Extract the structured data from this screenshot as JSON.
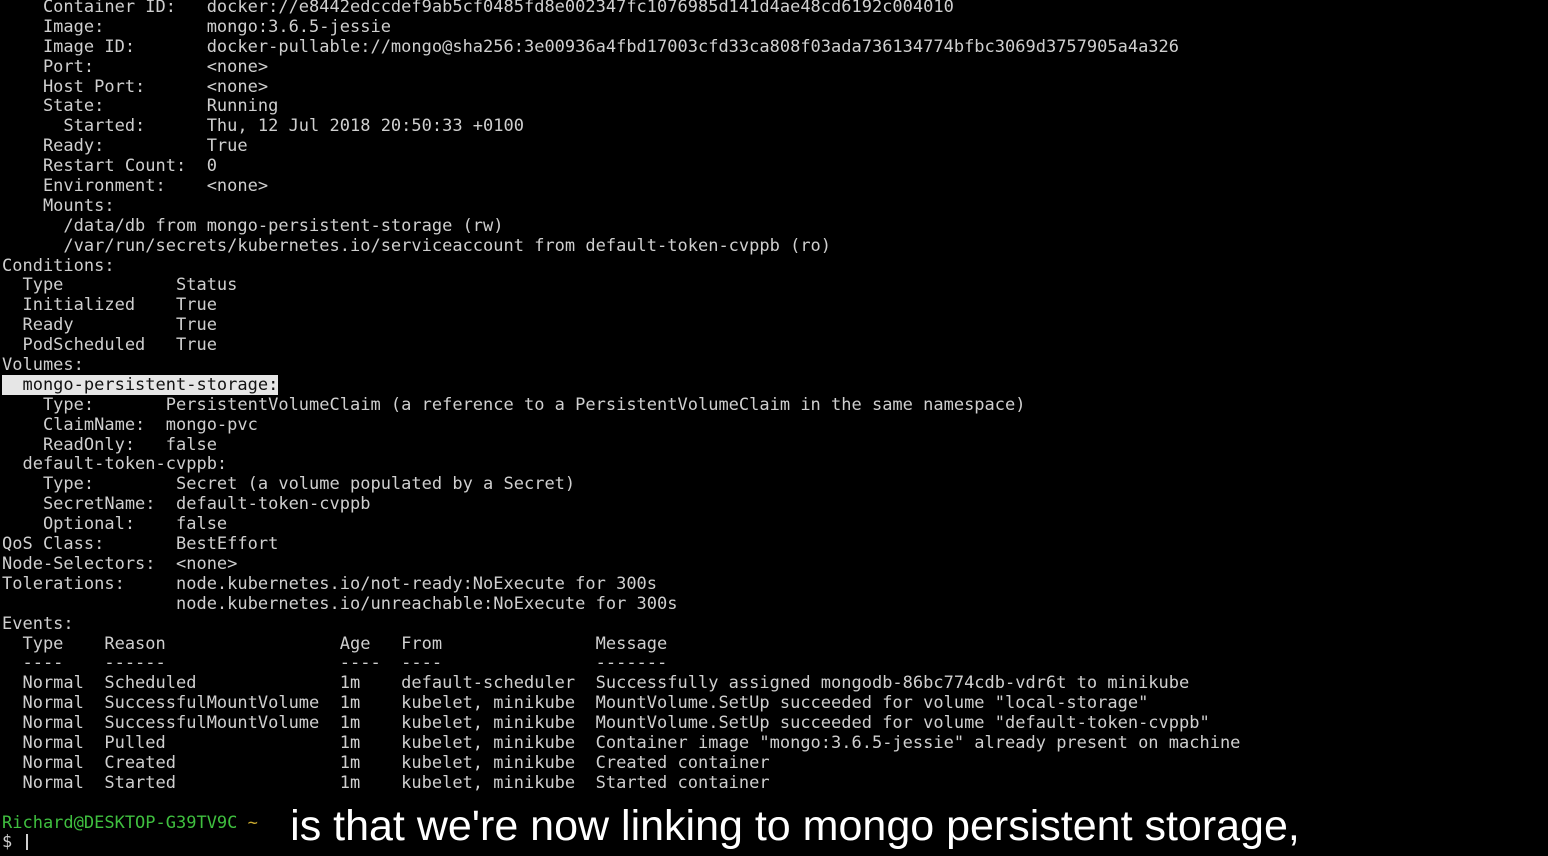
{
  "terminal": {
    "lines": [
      "    Container ID:   docker://e8442edccdef9ab5cf0485fd8e002347fc1076985d141d4ae48cd6192c004010",
      "    Image:          mongo:3.6.5-jessie",
      "    Image ID:       docker-pullable://mongo@sha256:3e00936a4fbd17003cfd33ca808f03ada736134774bfbc3069d3757905a4a326",
      "    Port:           <none>",
      "    Host Port:      <none>",
      "    State:          Running",
      "      Started:      Thu, 12 Jul 2018 20:50:33 +0100",
      "    Ready:          True",
      "    Restart Count:  0",
      "    Environment:    <none>",
      "    Mounts:",
      "      /data/db from mongo-persistent-storage (rw)",
      "      /var/run/secrets/kubernetes.io/serviceaccount from default-token-cvppb (ro)",
      "Conditions:",
      "  Type           Status",
      "  Initialized    True",
      "  Ready          True",
      "  PodScheduled   True",
      "Volumes:",
      "",
      "    Type:       PersistentVolumeClaim (a reference to a PersistentVolumeClaim in the same namespace)",
      "    ClaimName:  mongo-pvc",
      "    ReadOnly:   false",
      "  default-token-cvppb:",
      "    Type:        Secret (a volume populated by a Secret)",
      "    SecretName:  default-token-cvppb",
      "    Optional:    false",
      "QoS Class:       BestEffort",
      "Node-Selectors:  <none>",
      "Tolerations:     node.kubernetes.io/not-ready:NoExecute for 300s",
      "                 node.kubernetes.io/unreachable:NoExecute for 300s",
      "Events:",
      "  Type    Reason                 Age   From               Message",
      "  ----    ------                 ----  ----               -------",
      "  Normal  Scheduled              1m    default-scheduler  Successfully assigned mongodb-86bc774cdb-vdr6t to minikube",
      "  Normal  SuccessfulMountVolume  1m    kubelet, minikube  MountVolume.SetUp succeeded for volume \"local-storage\"",
      "  Normal  SuccessfulMountVolume  1m    kubelet, minikube  MountVolume.SetUp succeeded for volume \"default-token-cvppb\"",
      "  Normal  Pulled                 1m    kubelet, minikube  Container image \"mongo:3.6.5-jessie\" already present on machine",
      "  Normal  Created                1m    kubelet, minikube  Created container",
      "  Normal  Started                1m    kubelet, minikube  Started container",
      ""
    ],
    "highlighted_line": "  mongo-persistent-storage:",
    "prompt": {
      "user_host": "Richard@DESKTOP-G39TV9C",
      "path": "~",
      "second_line": "$ "
    }
  },
  "subtitle": "is that we're now linking to mongo persistent storage,",
  "colors": {
    "background": "#000000",
    "text": "#cfcfcf",
    "highlight_bg": "#e6e6e6",
    "prompt_user": "#3fbf3f",
    "prompt_path": "#c8a82e"
  }
}
